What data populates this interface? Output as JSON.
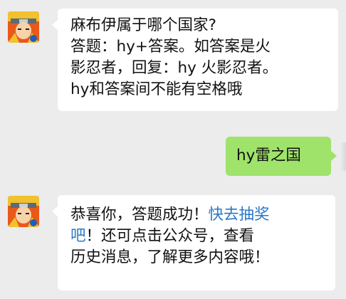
{
  "messages": [
    {
      "side": "left",
      "lines": [
        "麻布伊属于哪个国家?",
        "答题：hy+答案。如答案是火",
        "影忍者，回复：hy 火影忍者。",
        "hy和答案间不能有空格哦"
      ]
    },
    {
      "side": "right",
      "text": "hy雷之国"
    },
    {
      "side": "left",
      "line1_text": "恭喜你，答题成功！",
      "line1_link": "快去抽奖",
      "line2_link": "吧",
      "line2_text": "！还可点击公众号，查看",
      "line3_text": "历史消息，了解更多内容哦！"
    }
  ],
  "avatar_icon": "ninja-avatar-icon",
  "colors": {
    "background": "#ececec",
    "incoming_bubble": "#ffffff",
    "outgoing_bubble": "#9fe36a",
    "link": "#2a78c7"
  }
}
